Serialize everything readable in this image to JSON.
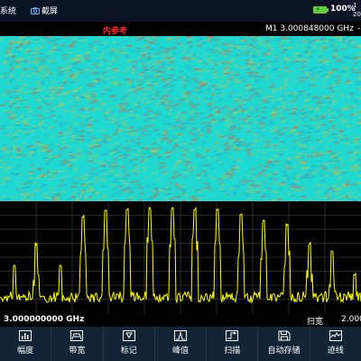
{
  "top_bar": {
    "system_label": "系统",
    "screenshot_label": "截屏",
    "battery_percent": "100%",
    "clock_top": "1",
    "clock_bottom": "20"
  },
  "marker_bar": {
    "ref_label": "内参考",
    "marker_readout": "M1  3.000848000 GHz",
    "trailing": "-"
  },
  "freq_bar": {
    "center_freq": "3.000000000 GHz",
    "span_label": "扫宽",
    "span_value": "2.000"
  },
  "softkeys": [
    {
      "label": "幅度",
      "icon": "amplitude-icon"
    },
    {
      "label": "带宽",
      "icon": "bandwidth-icon"
    },
    {
      "label": "标记",
      "icon": "marker-icon"
    },
    {
      "label": "峰值",
      "icon": "peak-icon"
    },
    {
      "label": "扫描",
      "icon": "sweep-icon"
    },
    {
      "label": "自动存储",
      "icon": "save-icon"
    },
    {
      "label": "迹线",
      "icon": "trace-icon"
    }
  ],
  "colors": {
    "waterfall_bg": "#1fd8d0",
    "trace": "#ffff00",
    "ref_label": "#ff2a2a",
    "softkey_bg": "#132437"
  }
}
